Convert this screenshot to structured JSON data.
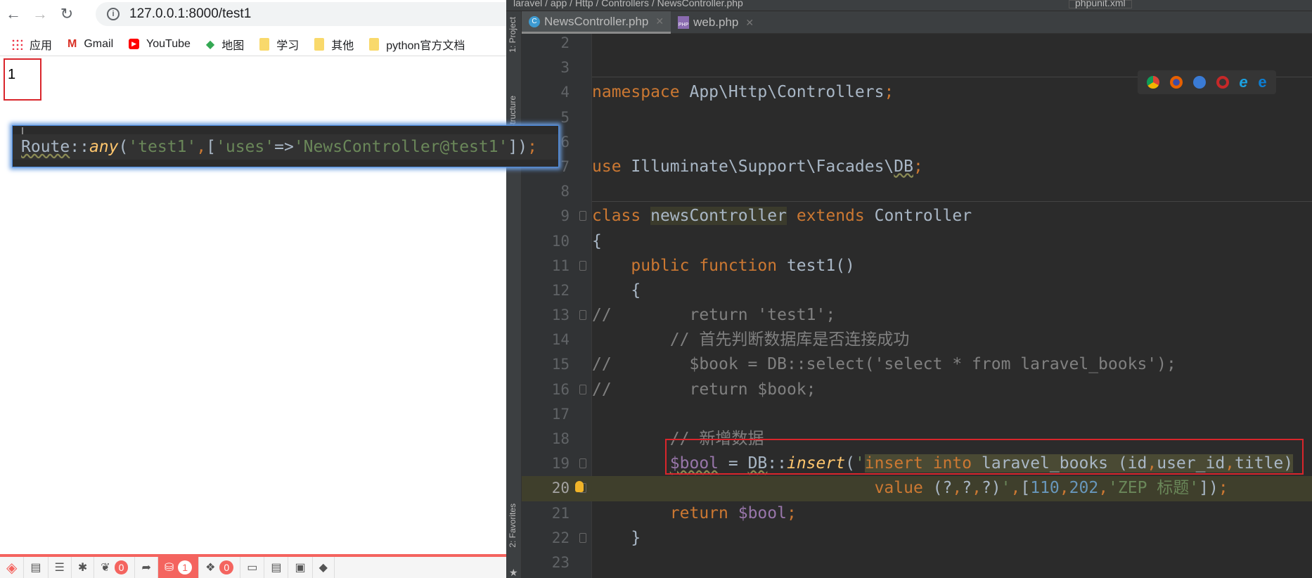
{
  "browser": {
    "url": "127.0.0.1:8000/test1",
    "bookmarks": [
      "应用",
      "Gmail",
      "YouTube",
      "地图",
      "学习",
      "其他",
      "python官方文档"
    ],
    "page_output": "1",
    "debugbar": {
      "badges": [
        "0",
        "1",
        "0"
      ],
      "accent": "#f4645f"
    }
  },
  "popup": {
    "tokens": [
      {
        "t": "Route",
        "c": "d w"
      },
      {
        "t": "::",
        "c": "d"
      },
      {
        "t": "any",
        "c": "f"
      },
      {
        "t": "(",
        "c": "d"
      },
      {
        "t": "'test1'",
        "c": "s"
      },
      {
        "t": ",",
        "c": "k"
      },
      {
        "t": "[",
        "c": "d"
      },
      {
        "t": "'uses'",
        "c": "s"
      },
      {
        "t": "=>",
        "c": "d"
      },
      {
        "t": "'NewsController@test1'",
        "c": "s"
      },
      {
        "t": "])",
        "c": "d"
      },
      {
        "t": ";",
        "c": "k"
      }
    ]
  },
  "ide": {
    "breadcrumb": "laravel / app / Http / Controllers / NewsController.php",
    "run_config": "phpunit.xml",
    "tool_windows": {
      "project": "1: Project",
      "structure": "Structure",
      "favorites": "2: Favorites"
    },
    "tabs": [
      {
        "label": "NewsController.php",
        "icon": "class-icon"
      },
      {
        "label": "web.php",
        "icon": "php-file-icon"
      }
    ],
    "current_line": "20",
    "lines": [
      {
        "n": "2",
        "tokens": []
      },
      {
        "n": "3",
        "tokens": []
      },
      {
        "n": "4",
        "tokens": [
          {
            "t": "namespace ",
            "c": "k"
          },
          {
            "t": "App\\Http\\Controllers",
            "c": "d"
          },
          {
            "t": ";",
            "c": "k"
          }
        ]
      },
      {
        "n": "5",
        "tokens": []
      },
      {
        "n": "6",
        "tokens": []
      },
      {
        "n": "7",
        "tokens": [
          {
            "t": "use ",
            "c": "k"
          },
          {
            "t": "Illuminate\\Support\\Facades\\",
            "c": "d"
          },
          {
            "t": "DB",
            "c": "d w"
          },
          {
            "t": ";",
            "c": "k"
          }
        ]
      },
      {
        "n": "8",
        "tokens": []
      },
      {
        "n": "9",
        "tokens": [
          {
            "t": "class ",
            "c": "k"
          },
          {
            "t": "newsController",
            "c": "d m1"
          },
          {
            "t": " extends ",
            "c": "k"
          },
          {
            "t": "Controller",
            "c": "d"
          }
        ]
      },
      {
        "n": "10",
        "tokens": [
          {
            "t": "{",
            "c": "d"
          }
        ]
      },
      {
        "n": "11",
        "tokens": [
          {
            "t": "    public function ",
            "c": "k"
          },
          {
            "t": "test1",
            "c": "d"
          },
          {
            "t": "()",
            "c": "d"
          }
        ]
      },
      {
        "n": "12",
        "tokens": [
          {
            "t": "    {",
            "c": "d"
          }
        ]
      },
      {
        "n": "13",
        "tokens": [
          {
            "t": "//        return 'test1';",
            "c": "c"
          }
        ]
      },
      {
        "n": "14",
        "tokens": [
          {
            "t": "        // 首先判断数据库是否连接成功",
            "c": "c"
          }
        ]
      },
      {
        "n": "15",
        "tokens": [
          {
            "t": "//        $book = DB::select('select * from laravel_books');",
            "c": "c"
          }
        ]
      },
      {
        "n": "16",
        "tokens": [
          {
            "t": "//        return $book;",
            "c": "c"
          }
        ]
      },
      {
        "n": "17",
        "tokens": []
      },
      {
        "n": "18",
        "tokens": [
          {
            "t": "        // 新增数据",
            "c": "c"
          }
        ]
      },
      {
        "n": "19",
        "tokens": [
          {
            "t": "        ",
            "c": "d"
          },
          {
            "t": "$bool",
            "c": "v w"
          },
          {
            "t": " = ",
            "c": "d"
          },
          {
            "t": "DB",
            "c": "d w"
          },
          {
            "t": "::",
            "c": "d"
          },
          {
            "t": "insert",
            "c": "f"
          },
          {
            "t": "(",
            "c": "d"
          },
          {
            "t": "'",
            "c": "s"
          },
          {
            "t": "insert into ",
            "c": "k m2"
          },
          {
            "t": "laravel_books (id",
            "c": "d m2"
          },
          {
            "t": ",",
            "c": "k m2"
          },
          {
            "t": "user_id",
            "c": "d m2"
          },
          {
            "t": ",",
            "c": "k m2"
          },
          {
            "t": "title)",
            "c": "d m2"
          }
        ]
      },
      {
        "n": "20",
        "tokens": [
          {
            "t": "                             ",
            "c": "d"
          },
          {
            "t": "value ",
            "c": "k"
          },
          {
            "t": "(?",
            "c": "d"
          },
          {
            "t": ",",
            "c": "k"
          },
          {
            "t": "?",
            "c": "d"
          },
          {
            "t": ",",
            "c": "k"
          },
          {
            "t": "?)",
            "c": "d"
          },
          {
            "t": "'",
            "c": "s"
          },
          {
            "t": ",",
            "c": "k"
          },
          {
            "t": "[",
            "c": "d"
          },
          {
            "t": "110",
            "c": "n"
          },
          {
            "t": ",",
            "c": "k"
          },
          {
            "t": "202",
            "c": "n"
          },
          {
            "t": ",",
            "c": "k"
          },
          {
            "t": "'ZEP 标题'",
            "c": "s"
          },
          {
            "t": "])",
            "c": "d"
          },
          {
            "t": ";",
            "c": "k"
          }
        ]
      },
      {
        "n": "21",
        "tokens": [
          {
            "t": "        return ",
            "c": "k"
          },
          {
            "t": "$bool",
            "c": "v"
          },
          {
            "t": ";",
            "c": "k"
          }
        ]
      },
      {
        "n": "22",
        "tokens": [
          {
            "t": "    }",
            "c": "d"
          }
        ]
      },
      {
        "n": "23",
        "tokens": []
      }
    ],
    "fold_lines": [
      "9",
      "11",
      "13",
      "16",
      "19",
      "20",
      "22"
    ],
    "colors": {
      "keyword": "#cc7832",
      "string": "#6a8759",
      "variable": "#9876aa",
      "number": "#6897bb",
      "comment": "#808080",
      "function": "#ffc66d",
      "background": "#2b2b2b"
    },
    "browser_preview_icons": [
      "chrome-icon",
      "firefox-icon",
      "safari-icon",
      "opera-icon",
      "ie-icon",
      "edge-icon"
    ]
  }
}
